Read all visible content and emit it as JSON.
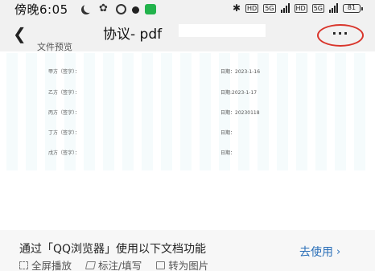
{
  "status_bar": {
    "time": "傍晚6:05",
    "network_tags": [
      "5G",
      "5G"
    ],
    "battery": "81"
  },
  "header": {
    "title": "协议- pdf",
    "subtitle": "文件预览",
    "back_icon": "chevron-left-icon",
    "more_label": "···",
    "highlight_color": "#d9352b"
  },
  "document": {
    "signature_rows": [
      {
        "party": "甲方（签字）：",
        "date": "日期：2023-1-16"
      },
      {
        "party": "乙方（签字）：",
        "date": "日期:2023-1-17"
      },
      {
        "party": "丙方（签字）：",
        "date": "日期：20230118"
      },
      {
        "party": "丁方（签字）：",
        "date": "日期："
      },
      {
        "party": "戊方（签字）：",
        "date": "日期："
      }
    ]
  },
  "banner": {
    "title": "通过「QQ浏览器」使用以下文档功能",
    "features": [
      {
        "icon": "fullscreen-icon",
        "label": "全屏播放"
      },
      {
        "icon": "edit-icon",
        "label": "标注/填写"
      },
      {
        "icon": "image-icon",
        "label": "转为图片"
      }
    ],
    "action_label": "去使用",
    "action_color": "#2a6fb8"
  }
}
